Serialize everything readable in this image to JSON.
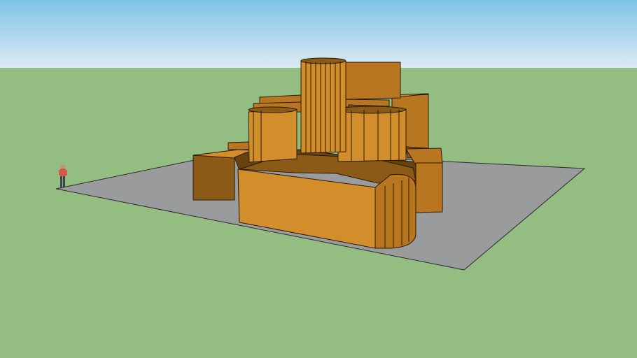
{
  "scene": {
    "description_type": "3d-model-viewport",
    "colors": {
      "sky_top": "#7fc3e6",
      "sky_bottom": "#dcebf4",
      "ground": "#94bd82",
      "base_plane": "#9a9b9c",
      "wood_light": "#d38e2c",
      "wood_mid": "#b87620",
      "wood_dark": "#8b5a17",
      "wood_shadow": "#684310",
      "edge": "#2a1a05",
      "figure_shirt": "#d35a4a",
      "figure_pants": "#3c4454"
    },
    "objects": [
      "sky",
      "ground",
      "base-plane",
      "wooden-structure",
      "scale-figure"
    ]
  }
}
